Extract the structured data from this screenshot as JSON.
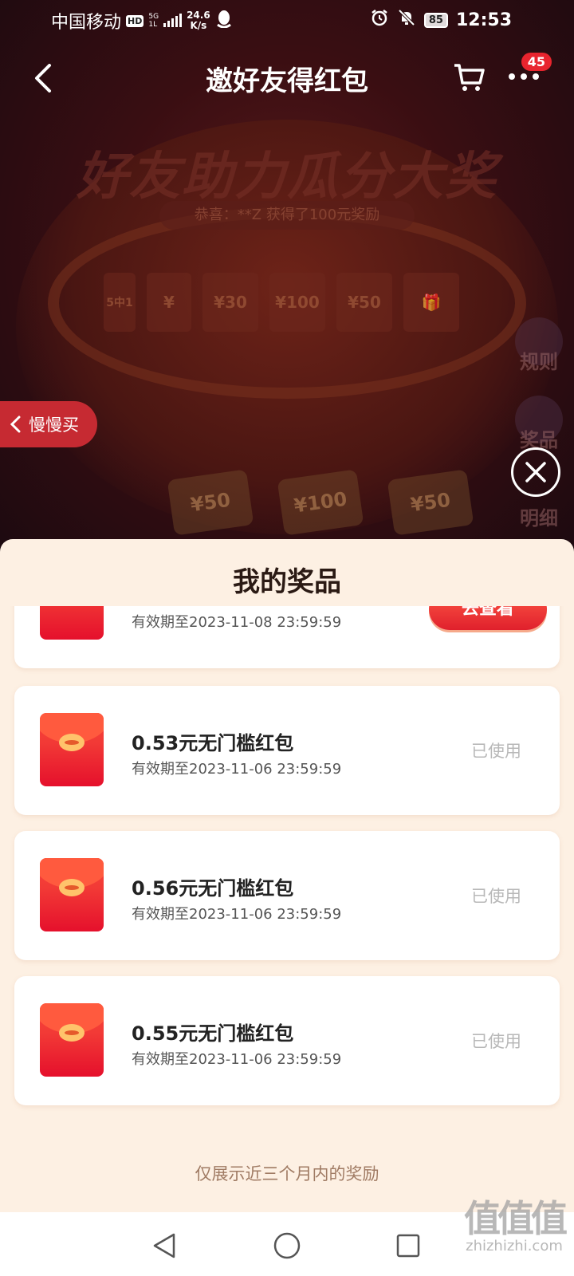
{
  "status_bar": {
    "carrier": "中国移动",
    "hd": "HD",
    "network": "5G",
    "network_sub": "1L",
    "speed_value": "24.6",
    "speed_unit": "K/s",
    "battery": "85",
    "time": "12:53"
  },
  "navbar": {
    "title": "邀好友得红包",
    "more_badge": "45"
  },
  "background": {
    "headline": "好友助力瓜分大奖",
    "ticker": "恭喜：**Z 获得了100元奖励",
    "prize_tiles": [
      "5中1",
      "¥",
      "¥30",
      "¥100",
      "¥50",
      "🎁"
    ],
    "side_rules": "规则",
    "side_prize": "奖品",
    "side_detail": "明细",
    "bottom_tiles": [
      "¥50",
      "¥100",
      "¥50"
    ]
  },
  "slow_buy": {
    "label": "慢慢买"
  },
  "sheet": {
    "title": "我的奖品",
    "items": [
      {
        "name": "",
        "expiry": "有效期至2023-11-08 23:59:59",
        "action": "去查看"
      },
      {
        "name": "0.53元无门槛红包",
        "expiry": "有效期至2023-11-06 23:59:59",
        "status": "已使用"
      },
      {
        "name": "0.56元无门槛红包",
        "expiry": "有效期至2023-11-06 23:59:59",
        "status": "已使用"
      },
      {
        "name": "0.55元无门槛红包",
        "expiry": "有效期至2023-11-06 23:59:59",
        "status": "已使用"
      }
    ],
    "footer_note": "仅展示近三个月内的奖励"
  },
  "watermark": {
    "logo": "值值值",
    "url": "zhizhizhi.com"
  },
  "colors": {
    "accent_red": "#e8242e",
    "sheet_bg": "#fdf0e3",
    "status_used": "#b8b8b8"
  }
}
